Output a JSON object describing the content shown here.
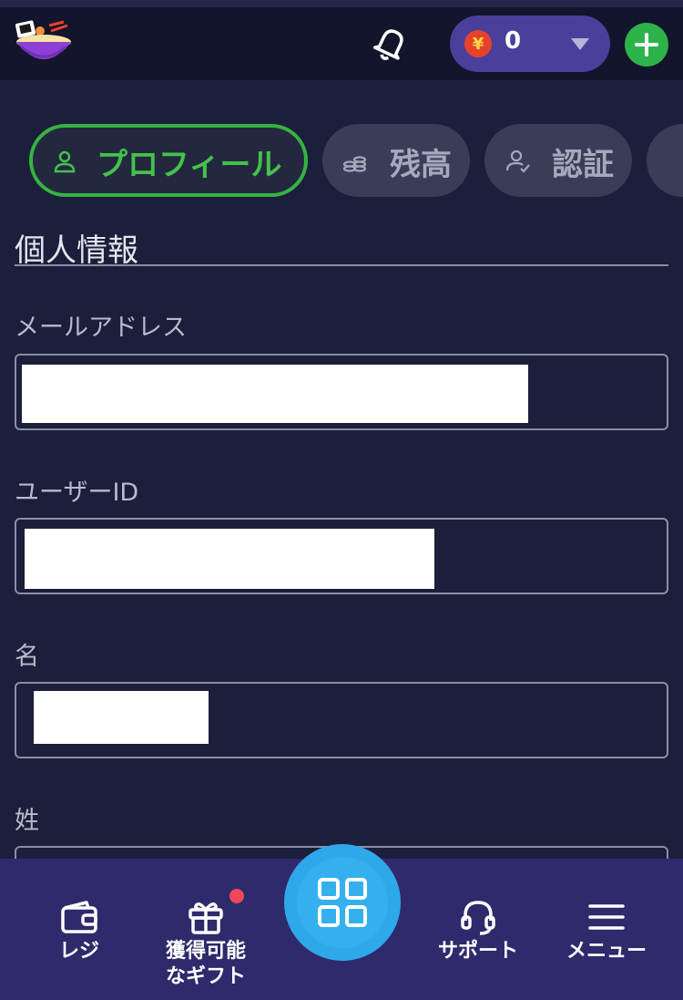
{
  "header": {
    "balance_currency_symbol": "¥",
    "balance_value": "0"
  },
  "tabs": [
    {
      "label": "プロフィール",
      "icon": "user-icon",
      "active": true
    },
    {
      "label": "残高",
      "icon": "coins-icon",
      "active": false
    },
    {
      "label": "認証",
      "icon": "user-check-icon",
      "active": false
    }
  ],
  "section": {
    "title": "個人情報"
  },
  "fields": [
    {
      "label": "メールアドレス",
      "value": ""
    },
    {
      "label": "ユーザーID",
      "value": ""
    },
    {
      "label": "名",
      "value": ""
    },
    {
      "label": "姓",
      "value": ""
    }
  ],
  "bottom_nav": {
    "cashier": "レジ",
    "gifts_line1": "獲得可能",
    "gifts_line2": "なギフト",
    "support": "サポート",
    "menu": "メニュー"
  },
  "colors": {
    "background": "#1b1f3b",
    "accent_green": "#36b341",
    "balance_pill": "#4a3f9b",
    "center_button": "#2fa8ea",
    "nav_bar": "#2e2a6b"
  }
}
